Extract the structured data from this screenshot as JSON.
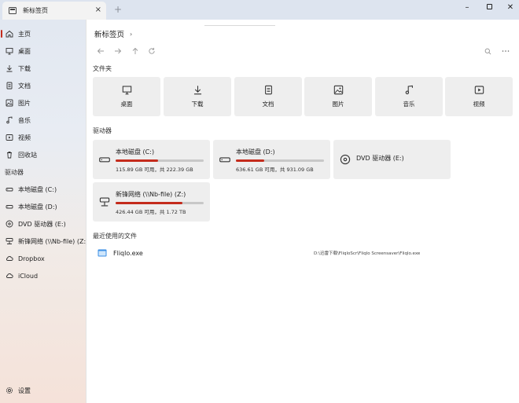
{
  "window": {
    "tab_title": "新标签页",
    "tab_close": "×",
    "new_tab": "+",
    "minimize": "–",
    "close": "✕"
  },
  "sidebar": {
    "items": [
      {
        "label": "主页",
        "icon": "home-icon",
        "active": true
      },
      {
        "label": "桌面",
        "icon": "desktop-icon"
      },
      {
        "label": "下载",
        "icon": "download-icon"
      },
      {
        "label": "文档",
        "icon": "document-icon"
      },
      {
        "label": "图片",
        "icon": "picture-icon"
      },
      {
        "label": "音乐",
        "icon": "music-icon"
      },
      {
        "label": "视频",
        "icon": "video-icon"
      },
      {
        "label": "回收站",
        "icon": "recycle-bin-icon"
      }
    ],
    "drives_header": "驱动器",
    "drives": [
      {
        "label": "本地磁盘 (C:)",
        "icon": "drive-icon"
      },
      {
        "label": "本地磁盘 (D:)",
        "icon": "drive-icon"
      },
      {
        "label": "DVD 驱动器 (E:)",
        "icon": "dvd-icon"
      },
      {
        "label": "新锋网络 (\\\\Nb-file) (Z:)",
        "icon": "network-drive-icon"
      },
      {
        "label": "Dropbox",
        "icon": "cloud-icon"
      },
      {
        "label": "iCloud",
        "icon": "cloud-icon"
      }
    ],
    "settings_label": "设置"
  },
  "main": {
    "breadcrumb": "新标签页",
    "breadcrumb_chevron": "›",
    "folders_title": "文件夹",
    "folders": [
      {
        "label": "桌面",
        "icon": "desktop-icon"
      },
      {
        "label": "下载",
        "icon": "download-icon"
      },
      {
        "label": "文档",
        "icon": "document-icon"
      },
      {
        "label": "图片",
        "icon": "picture-icon"
      },
      {
        "label": "音乐",
        "icon": "music-icon"
      },
      {
        "label": "视频",
        "icon": "video-icon"
      }
    ],
    "drives_title": "驱动器",
    "drives": [
      {
        "name": "本地磁盘 (C:)",
        "info": "115.89 GB 可用，共 222.39 GB",
        "used_fraction": 0.48
      },
      {
        "name": "本地磁盘 (D:)",
        "info": "636.61 GB 可用，共 931.09 GB",
        "used_fraction": 0.32
      },
      {
        "name": "DVD 驱动器 (E:)"
      },
      {
        "name": "新锋网络 (\\\\Nb-file) (Z:)",
        "info": "426.44 GB 可用，共 1.72 TB",
        "used_fraction": 0.76
      }
    ],
    "recent_title": "最近使用的文件",
    "recent": [
      {
        "name": "Fliqlo.exe",
        "path": "D:\\迅雷下载\\FliqloScr\\Fliqlo Screensaver\\Fliqlo.exe"
      }
    ]
  },
  "colors": {
    "accent": "#c42b1c",
    "tile_bg": "#eeeeee",
    "titlebar": "#dde4ef"
  }
}
